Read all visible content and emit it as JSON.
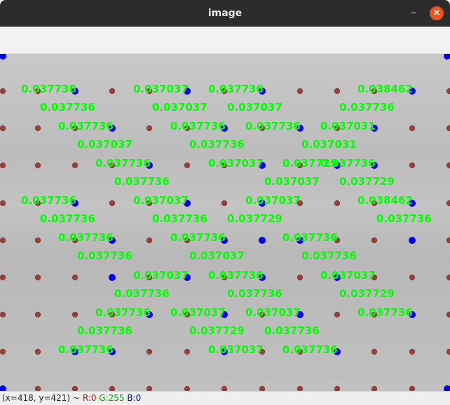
{
  "window": {
    "title": "image",
    "minimize_glyph": "–",
    "close_glyph": "×"
  },
  "status": {
    "coords": "(x=418, y=421) ~",
    "r": "R:0",
    "g": "G:255",
    "b": "B:0"
  },
  "colors": {
    "label": "#00ff00",
    "blue_dot": "#0000ee",
    "red_dot": "#8a2a2a"
  },
  "labels": [
    {
      "text": "0.037736"
    },
    {
      "text": "0.037037"
    },
    {
      "text": "0.037736"
    },
    {
      "text": "0.038462"
    },
    {
      "text": "0.037736"
    },
    {
      "text": "0.037037"
    },
    {
      "text": "0.037037"
    },
    {
      "text": "0.037736"
    },
    {
      "text": "0.037736"
    },
    {
      "text": "0.037736"
    },
    {
      "text": "0.037736"
    },
    {
      "text": "0.037031"
    },
    {
      "text": "0.037037"
    },
    {
      "text": "0.037736"
    },
    {
      "text": "0.037031"
    },
    {
      "text": "0.037736"
    },
    {
      "text": "0.037037"
    },
    {
      "text": "0.037729"
    },
    {
      "text": "0.037736"
    },
    {
      "text": "0.037736"
    },
    {
      "text": "0.037037"
    },
    {
      "text": "0.037729"
    },
    {
      "text": "0.037736"
    },
    {
      "text": "0.037037"
    },
    {
      "text": "0.037037"
    },
    {
      "text": "0.038462"
    },
    {
      "text": "0.037736"
    },
    {
      "text": "0.037736"
    },
    {
      "text": "0.037729"
    },
    {
      "text": "0.037736"
    },
    {
      "text": "0.037736"
    },
    {
      "text": "0.037736"
    },
    {
      "text": "0.037736"
    },
    {
      "text": "0.037736"
    },
    {
      "text": "0.037037"
    },
    {
      "text": "0.037736"
    },
    {
      "text": "0.037037"
    },
    {
      "text": "0.037736"
    },
    {
      "text": "0.037037"
    },
    {
      "text": "0.037736"
    },
    {
      "text": "0.037736"
    },
    {
      "text": "0.037729"
    },
    {
      "text": "0.037736"
    },
    {
      "text": "0.037037"
    },
    {
      "text": "0.037037"
    },
    {
      "text": "0.037736"
    },
    {
      "text": "0.037736"
    },
    {
      "text": "0.037729"
    },
    {
      "text": "0.037736"
    },
    {
      "text": "0.037736"
    },
    {
      "text": "0.037037"
    },
    {
      "text": "0.037736"
    }
  ]
}
